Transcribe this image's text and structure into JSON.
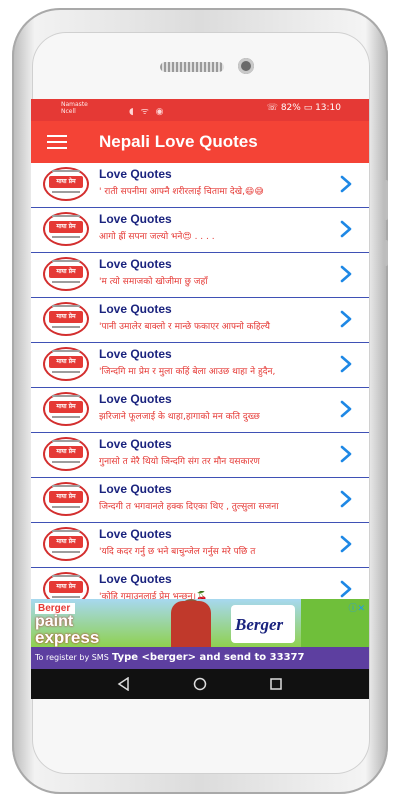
{
  "status_bar": {
    "carrier_line1": "Namaste",
    "carrier_line2": "Ncell",
    "icons": "◖ ᯤ ◉",
    "battery_text": "☏ 82% ▭ 13:10"
  },
  "app_bar": {
    "title": "Nepali Love Quotes",
    "menu_icon": "hamburger-menu-icon"
  },
  "thumb_text": "माया प्रेम",
  "items": [
    {
      "title": "Love Quotes",
      "quote": "' राती सपनीमा आफ्नै शरीरलाई चितामा देखे,😄😅"
    },
    {
      "title": "Love Quotes",
      "quote": "आगो ह्रीं सपना जल्यो भने😍 . . . ."
    },
    {
      "title": "Love Quotes",
      "quote": "'म त्यो समाजको खोजीमा छु जहाँ"
    },
    {
      "title": "Love Quotes",
      "quote": "'पानी उमालेर बाक्लो र मान्छे फकाएर आफ्नो कहिल्यै"
    },
    {
      "title": "Love Quotes",
      "quote": "'जिन्दगि मा प्रेम र मुला कहिं बेला आउछ थाहा ने हुदैन,"
    },
    {
      "title": "Love Quotes",
      "quote": "झरिजाने फूलजाई के थाहा,हागाको मन कति दुख्छ"
    },
    {
      "title": "Love Quotes",
      "quote": "गुनासो त मेरै थियो जिन्दगि संग  तर मौन यसकारण"
    },
    {
      "title": "Love Quotes",
      "quote": "जिन्दगी त भगवानले हक्क दिएका थिए , तुल्सुला सजना"
    },
    {
      "title": "Love Quotes",
      "quote": "'यदि कदर गर्नु छ भने बाचुन्जेल गर्नुस मरे पछि त"
    },
    {
      "title": "Love Quotes",
      "quote": "'कोहि गुमाउनुलाई प्रेम भन्छन।🍒"
    }
  ],
  "ad": {
    "brand_top": "Berger",
    "brand_line1": "paint",
    "brand_line2": "express",
    "logo": "Berger",
    "bottom_sms": "To register by SMS",
    "bottom_text": "Type <berger> and send to 33377"
  },
  "nav": {
    "back": "back-icon",
    "home": "home-icon",
    "recents": "recents-icon"
  },
  "colors": {
    "status_bar": "#e53935",
    "app_bar": "#f44336",
    "title_text": "#1a237e",
    "quote_text": "#e53935",
    "divider": "#3f51b5",
    "chevron": "#1e88e5"
  }
}
